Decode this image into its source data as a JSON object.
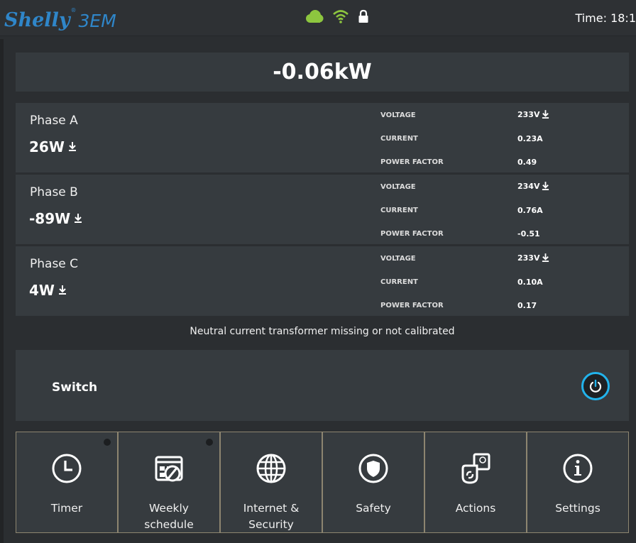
{
  "header": {
    "brand_script": "Shelly",
    "brand_registered": "®",
    "brand_model": "3EM",
    "time": "Time: 18:1",
    "icons": [
      "cloud-icon",
      "wifi-icon",
      "lock-icon"
    ],
    "colors": {
      "brand": "#2f86c9",
      "cloud": "#8dc63f",
      "wifi": "#8dc63f"
    }
  },
  "total_power": "-0.06kW",
  "phases": [
    {
      "name": "Phase A",
      "power": "26W",
      "voltage_label": "VOLTAGE",
      "voltage": "233V",
      "current_label": "CURRENT",
      "current": "0.23A",
      "pf_label": "POWER FACTOR",
      "pf": "0.49"
    },
    {
      "name": "Phase B",
      "power": "-89W",
      "voltage_label": "VOLTAGE",
      "voltage": "234V",
      "current_label": "CURRENT",
      "current": "0.76A",
      "pf_label": "POWER FACTOR",
      "pf": "-0.51"
    },
    {
      "name": "Phase C",
      "power": "4W",
      "voltage_label": "VOLTAGE",
      "voltage": "233V",
      "current_label": "CURRENT",
      "current": "0.10A",
      "pf_label": "POWER FACTOR",
      "pf": "0.17"
    }
  ],
  "notice": "Neutral current transformer missing or not calibrated",
  "switch": {
    "label": "Switch",
    "icon": "power-icon",
    "color": "#22b3ec"
  },
  "menu": [
    {
      "label1": "Timer",
      "label2": "",
      "icon": "clock-icon"
    },
    {
      "label1": "Weekly",
      "label2": "schedule",
      "icon": "schedule-icon"
    },
    {
      "label1": "Internet &",
      "label2": "Security",
      "icon": "globe-icon"
    },
    {
      "label1": "Safety",
      "label2": "",
      "icon": "shield-icon"
    },
    {
      "label1": "Actions",
      "label2": "",
      "icon": "actions-icon"
    },
    {
      "label1": "Settings",
      "label2": "",
      "icon": "info-icon"
    }
  ]
}
